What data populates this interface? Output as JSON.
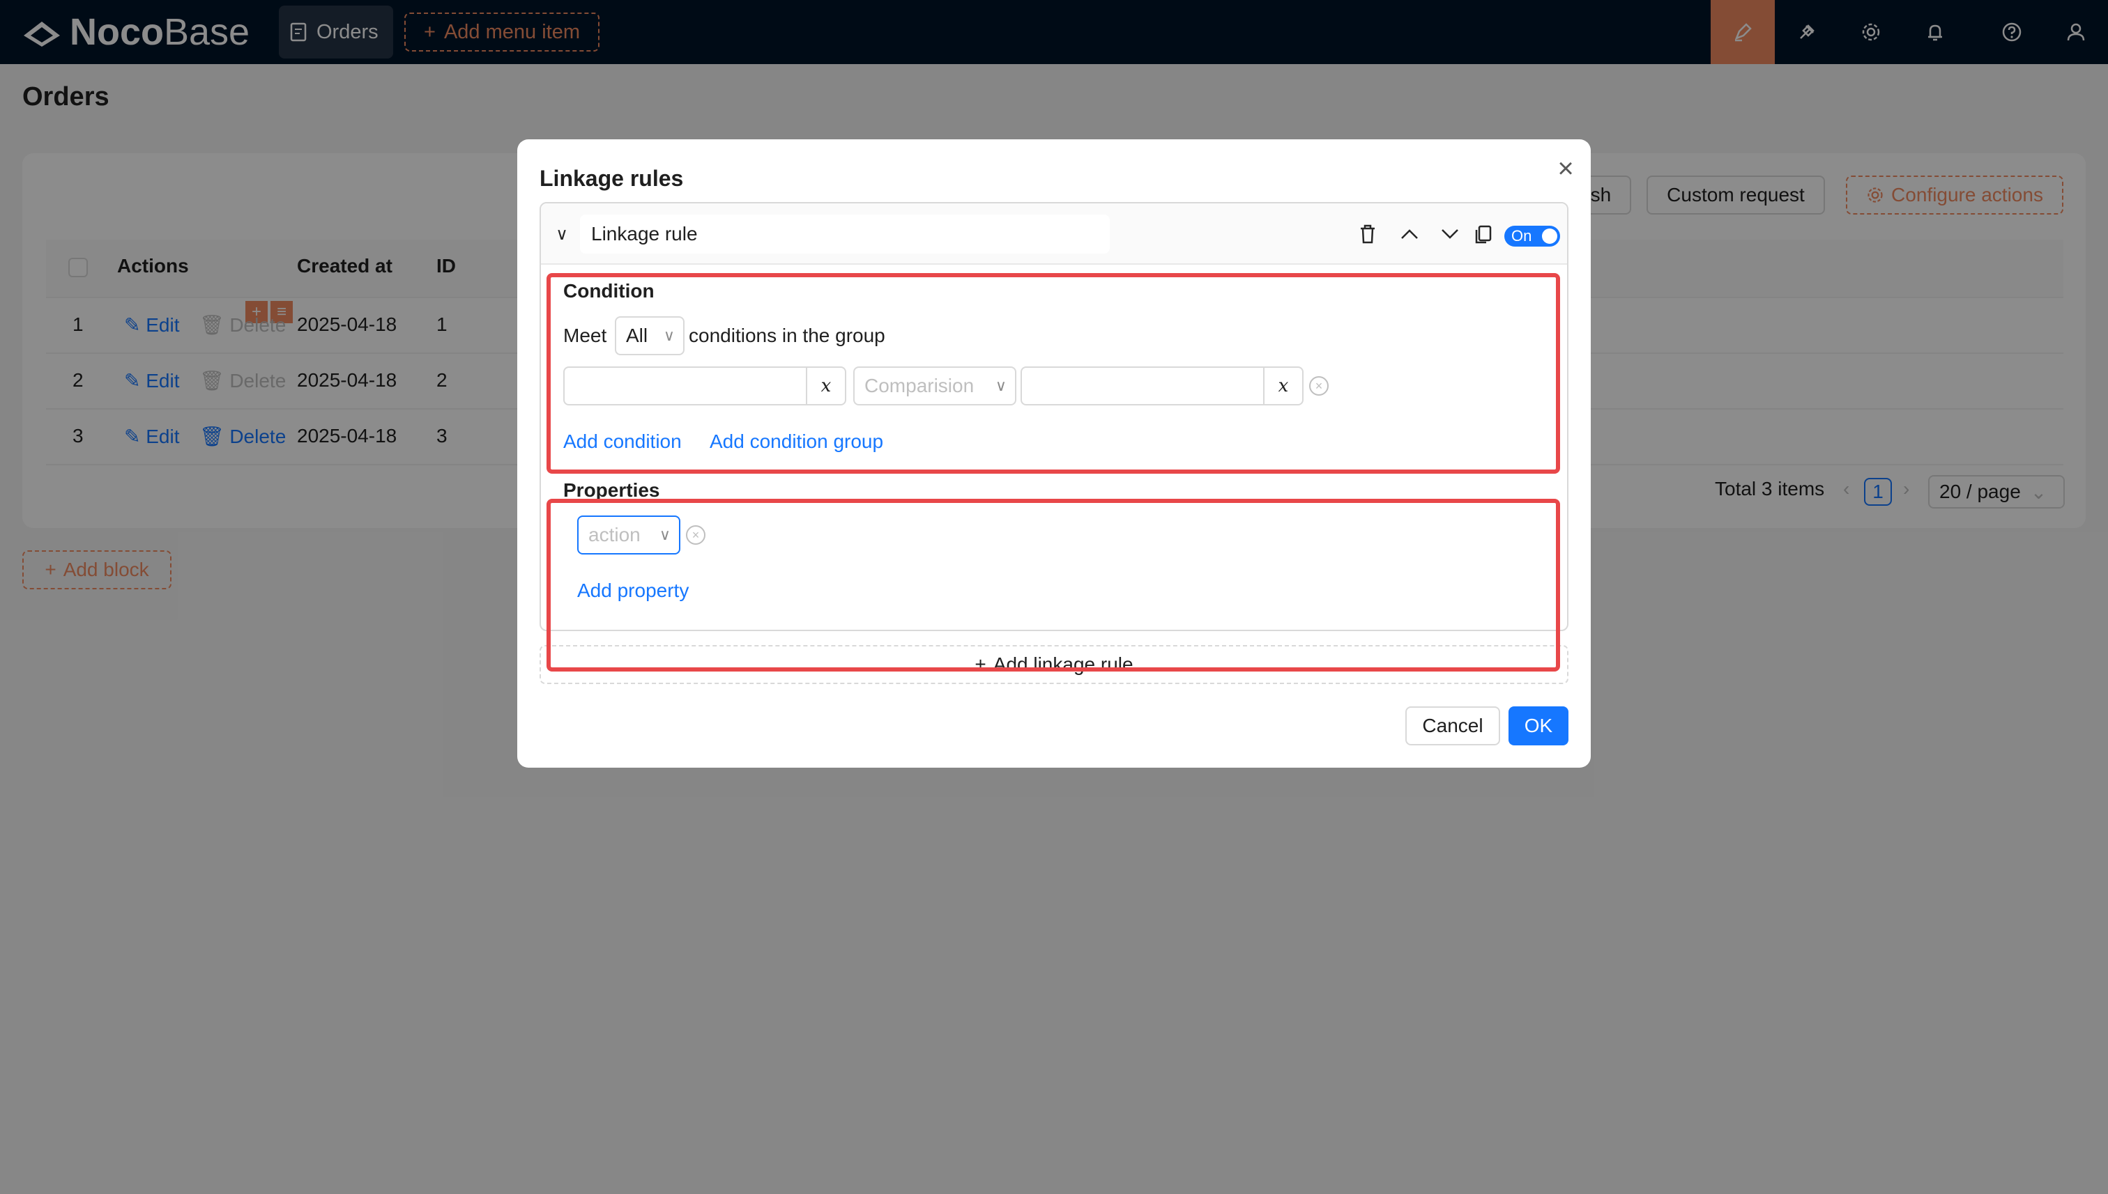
{
  "topbar": {
    "logo_bold": "Noco",
    "logo_thin": "Base",
    "menu_orders": "Orders",
    "add_menu_item": "Add menu item"
  },
  "page": {
    "title": "Orders",
    "toolbar": {
      "refresh_partial": "esh",
      "custom_request": "Custom request",
      "configure_actions": "Configure actions"
    },
    "table": {
      "headers": [
        "Actions",
        "Created at",
        "ID"
      ],
      "rows": [
        {
          "no": "1",
          "edit": "Edit",
          "delete": "Delete",
          "created_at": "2025-04-18",
          "id": "1"
        },
        {
          "no": "2",
          "edit": "Edit",
          "delete": "Delete",
          "created_at": "2025-04-18",
          "id": "2"
        },
        {
          "no": "3",
          "edit": "Edit",
          "delete": "Delete",
          "created_at": "2025-04-18",
          "id": "3"
        }
      ]
    },
    "pagination": {
      "total": "Total 3 items",
      "current": "1",
      "page_size": "20 / page"
    },
    "add_block": "Add block"
  },
  "modal": {
    "title": "Linkage rules",
    "rule": {
      "name": "Linkage rule",
      "toggle_label": "On"
    },
    "condition": {
      "label": "Condition",
      "meet_prefix": "Meet",
      "meet_value": "All",
      "meet_suffix": "conditions in the group",
      "var_symbol": "x",
      "comparison_placeholder": "Comparision",
      "add_condition": "Add condition",
      "add_condition_group": "Add condition group"
    },
    "properties": {
      "label": "Properties",
      "action_placeholder": "action",
      "add_property": "Add property"
    },
    "add_linkage_rule": "Add linkage rule",
    "cancel": "Cancel",
    "ok": "OK"
  },
  "colors": {
    "accent": "#1677ff",
    "brand": "#f18b62",
    "highlight": "#e84749",
    "header": "#001529"
  }
}
